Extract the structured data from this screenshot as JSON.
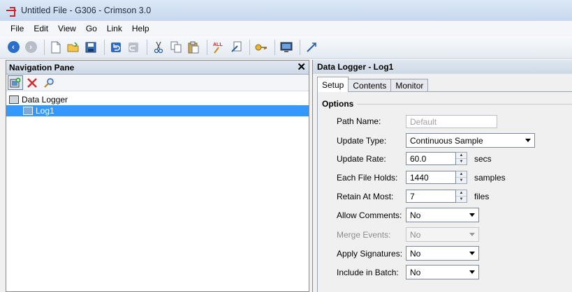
{
  "window": {
    "title": "Untitled File - G306 - Crimson 3.0"
  },
  "menu": [
    "File",
    "Edit",
    "View",
    "Go",
    "Link",
    "Help"
  ],
  "toolbar": {
    "icons": [
      "back-icon",
      "forward-icon",
      "new-file-icon",
      "open-folder-icon",
      "save-icon",
      "undo-icon",
      "redo-icon",
      "cut-icon",
      "copy-icon",
      "paste-icon",
      "find-all-icon",
      "edit-icon",
      "key-icon",
      "monitor-icon",
      "link-icon"
    ]
  },
  "nav": {
    "title": "Navigation Pane",
    "close_glyph": "✕",
    "tree": {
      "root": "Data Logger",
      "child": "Log1"
    }
  },
  "panel": {
    "title": "Data Logger - Log1",
    "tabs": [
      "Setup",
      "Contents",
      "Monitor"
    ],
    "section": "Options",
    "fields": {
      "path_name": {
        "label": "Path Name:",
        "value": "Default"
      },
      "update_type": {
        "label": "Update Type:",
        "value": "Continuous Sample"
      },
      "update_rate": {
        "label": "Update Rate:",
        "value": "60.0",
        "unit": "secs"
      },
      "file_holds": {
        "label": "Each File Holds:",
        "value": "1440",
        "unit": "samples"
      },
      "retain": {
        "label": "Retain At Most:",
        "value": "7",
        "unit": "files"
      },
      "allow_comments": {
        "label": "Allow Comments:",
        "value": "No"
      },
      "merge_events": {
        "label": "Merge Events:",
        "value": "No"
      },
      "apply_signatures": {
        "label": "Apply Signatures:",
        "value": "No"
      },
      "include_batch": {
        "label": "Include in Batch:",
        "value": "No"
      }
    }
  }
}
